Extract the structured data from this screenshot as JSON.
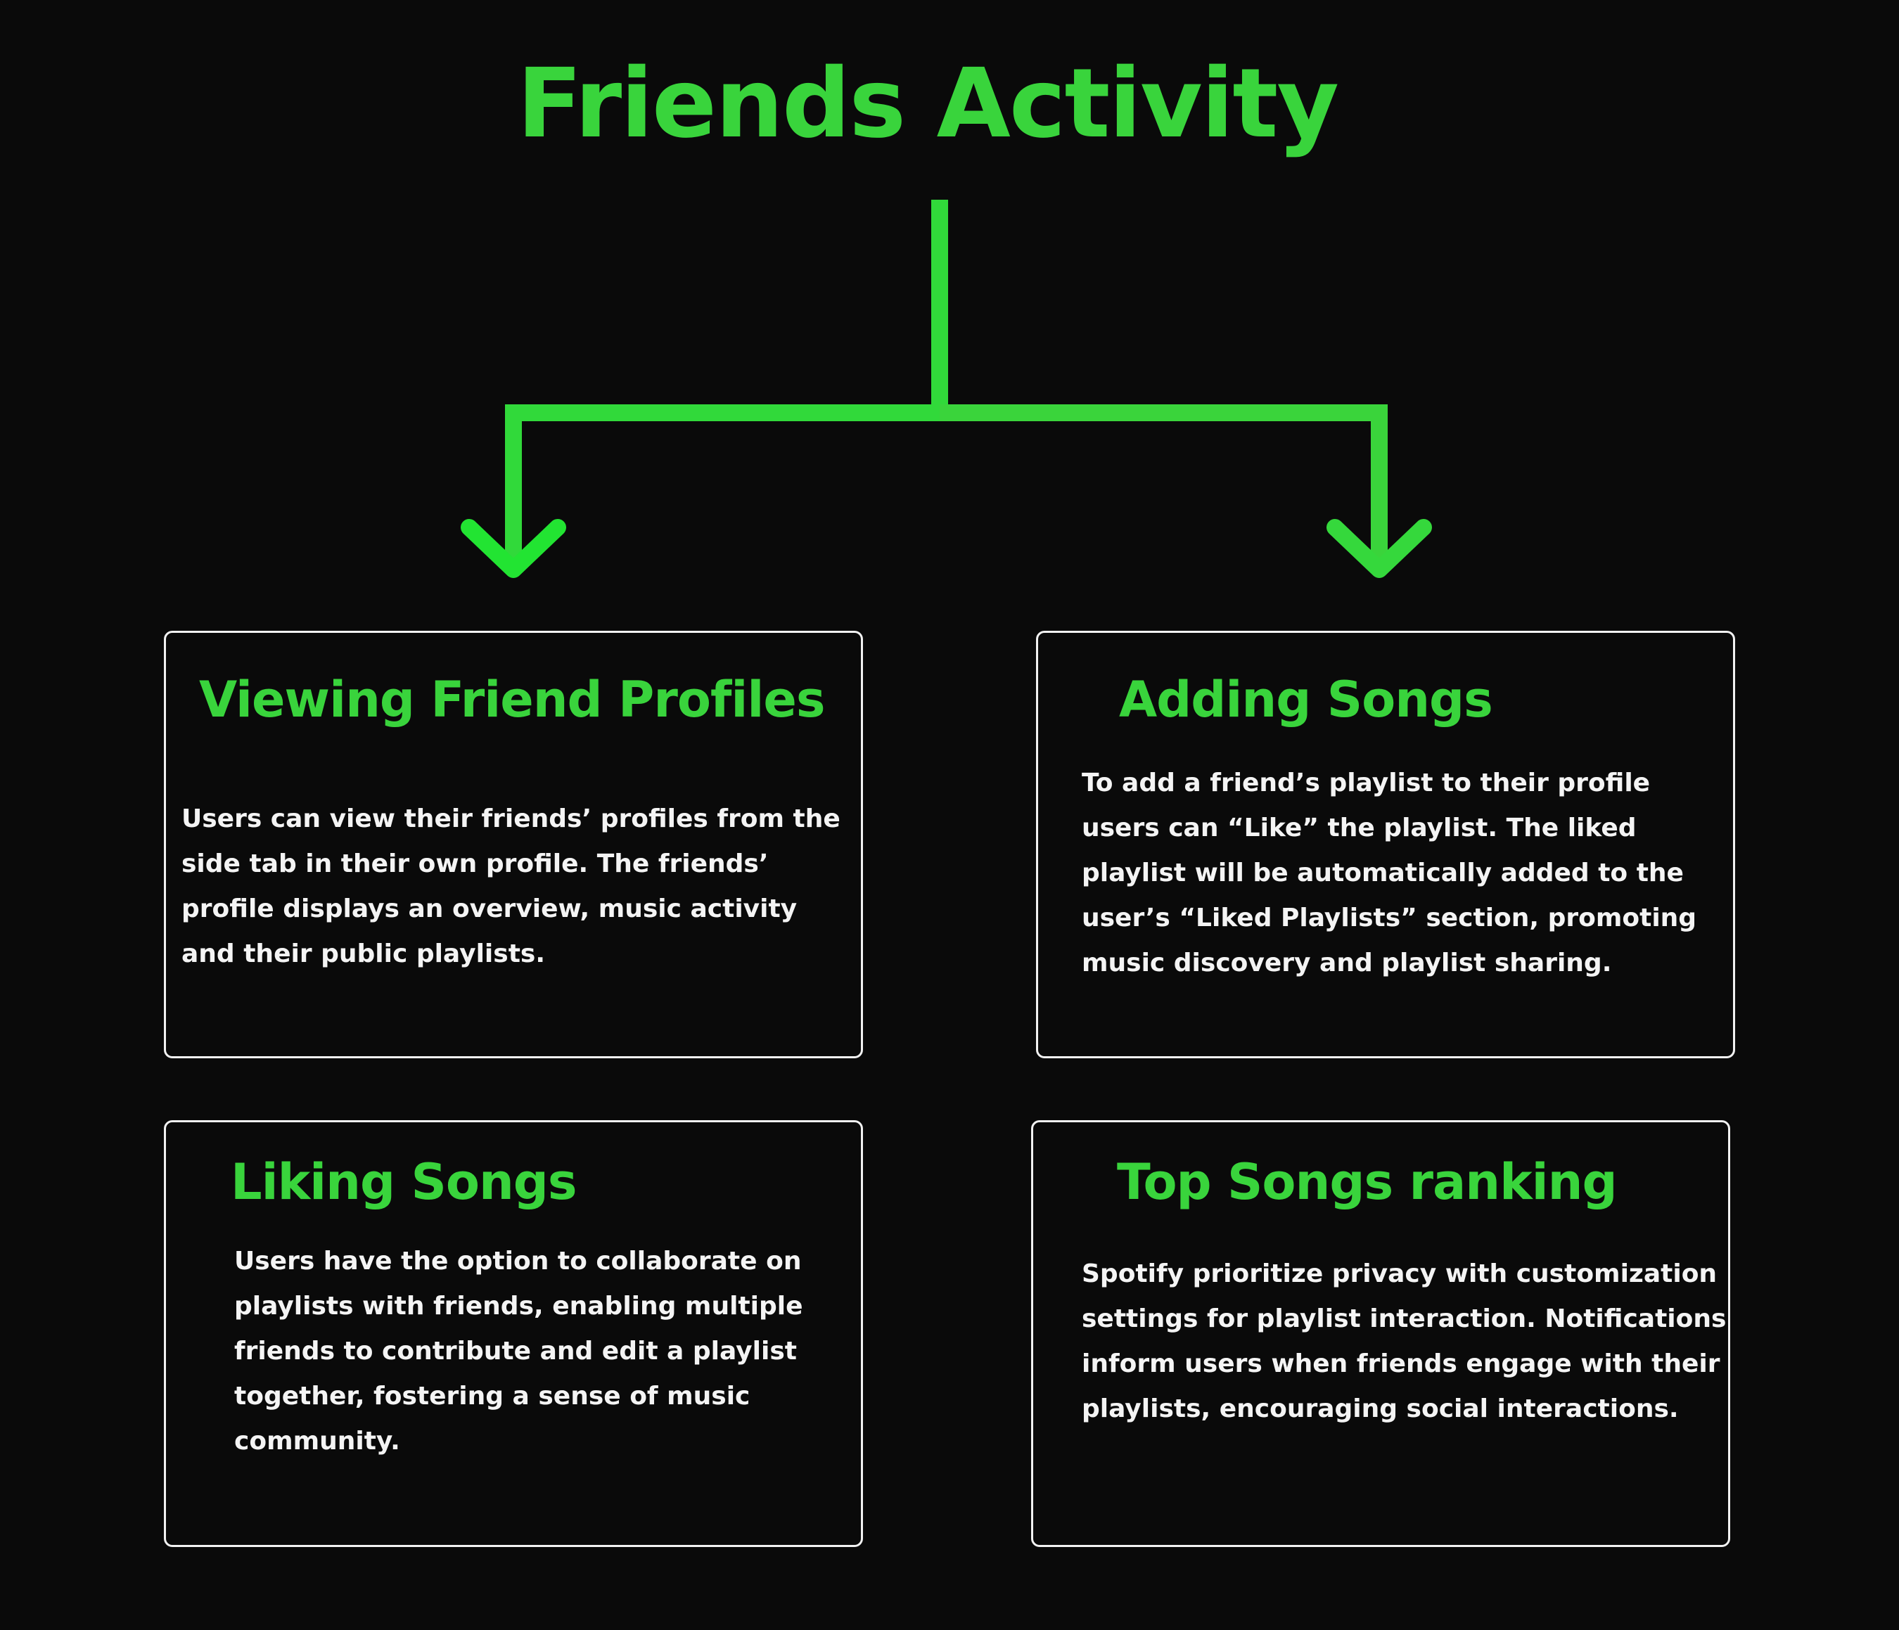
{
  "title": "Friends Activity",
  "accent_color": "#39d43c",
  "background_color": "#0a0a0a",
  "border_color": "#f2f2f2",
  "cards": [
    {
      "title": "Viewing Friend Profiles",
      "text": "Users can view their friends’ profiles from the side tab in their own profile. The friends’ profile displays an overview, music activity and their public playlists."
    },
    {
      "title": "Adding Songs",
      "text": "To add a friend’s playlist to their profile users can “Like” the playlist. The liked playlist will be automatically added to the user’s “Liked Playlists” section, promoting music discovery and playlist sharing."
    },
    {
      "title": "Liking Songs",
      "text": "Users have the option to collaborate on playlists with friends, enabling multiple friends to contribute and edit a playlist together, fostering a sense of music community."
    },
    {
      "title": "Top Songs ranking",
      "text": "Spotify prioritize privacy with customization settings for playlist interaction. Notifications inform users when friends engage with their playlists, encouraging social interactions."
    }
  ]
}
